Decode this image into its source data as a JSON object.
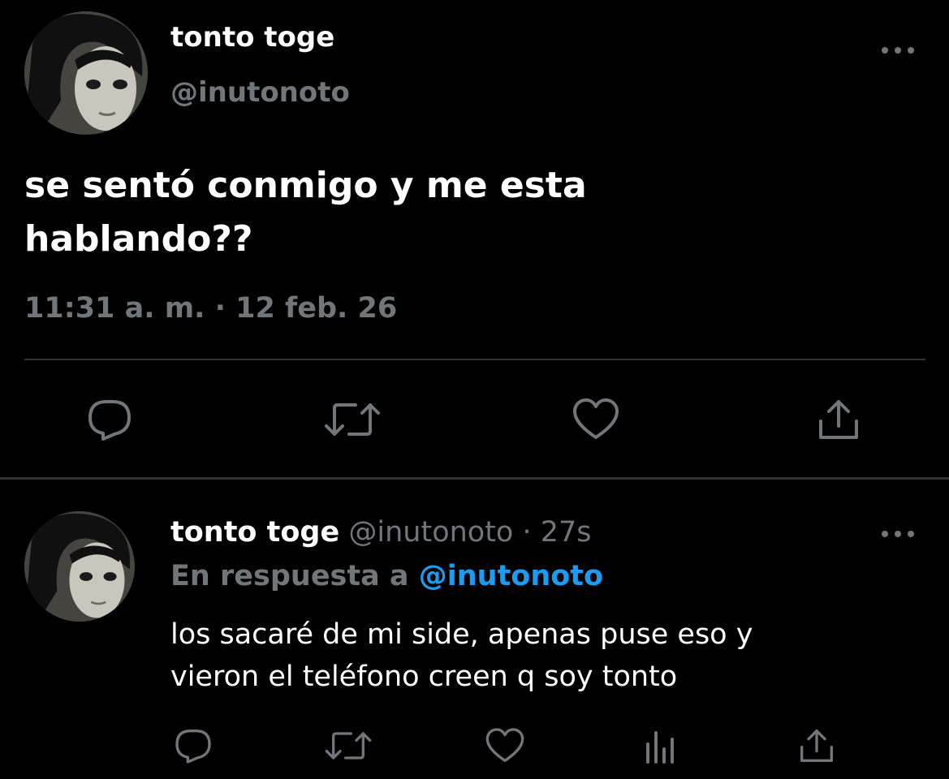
{
  "main_tweet": {
    "display_name": "tonto toge",
    "handle": "@inutonoto",
    "text": "se sentó conmigo y me esta\nhablando??",
    "timestamp": "11:31 a. m. · 12 feb. 26",
    "more_icon": "more-horizontal-icon",
    "actions": {
      "reply_icon": "reply-icon",
      "retweet_icon": "retweet-icon",
      "like_icon": "heart-icon",
      "share_icon": "share-icon"
    }
  },
  "reply_tweet": {
    "display_name": "tonto toge",
    "handle": "@inutonoto",
    "separator": "·",
    "age": "27s",
    "reply_prefix": "En respuesta a",
    "reply_mention": "@inutonoto",
    "text": "los sacaré de mi side, apenas puse eso y\nvieron el teléfono creen q soy tonto",
    "more_icon": "more-horizontal-icon",
    "actions": {
      "reply_icon": "reply-icon",
      "retweet_icon": "retweet-icon",
      "like_icon": "heart-icon",
      "stats_icon": "analytics-icon",
      "share_icon": "share-icon"
    }
  },
  "colors": {
    "background": "#000000",
    "primary_text": "#ffffff",
    "secondary_text": "#71767b",
    "link": "#1d9bf0",
    "divider": "#2f3336"
  }
}
